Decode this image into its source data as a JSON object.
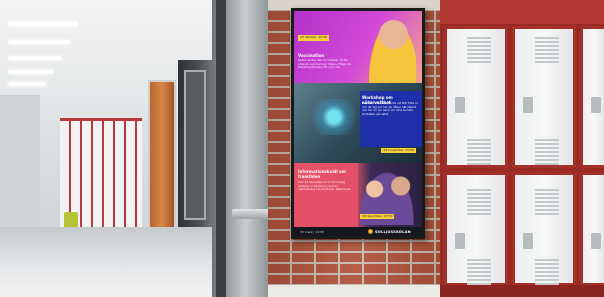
{
  "scene": {
    "description_colors": {
      "brick": "#b4553d",
      "locker_red": "#9c2a24",
      "locker_door": "#eceeef",
      "sign_accent_yellow": "#f7cf3a"
    }
  },
  "signage": {
    "tiles": [
      {
        "date": "23 oktober, 14:30",
        "heading": "Vaccination",
        "body": "Nästa vecka, den 23 oktober 14:30, erbjuds vaccinering i hallen. Fråga din klassföreståndare för mer info."
      },
      {
        "heading": "Workshop om näturvetthet",
        "body": "Den 13 november 15:00 vid BIP. Titta in och lär dig om hur du håller nät säkert och hur du tar hand om dina sociala kontakter på nätet.",
        "date": "13 november, 15:00"
      },
      {
        "heading": "Informationskväll om framtiden",
        "body": "Den 18 december kl 17:30 lördag avslutas vi terminen med en uppdatering om studieval. Välkomna!",
        "date": "18 december, 17:30"
      }
    ],
    "footer": {
      "datetime": "15 mars  |  14:55",
      "brand": "SOLLJUSSKOLAN"
    }
  }
}
